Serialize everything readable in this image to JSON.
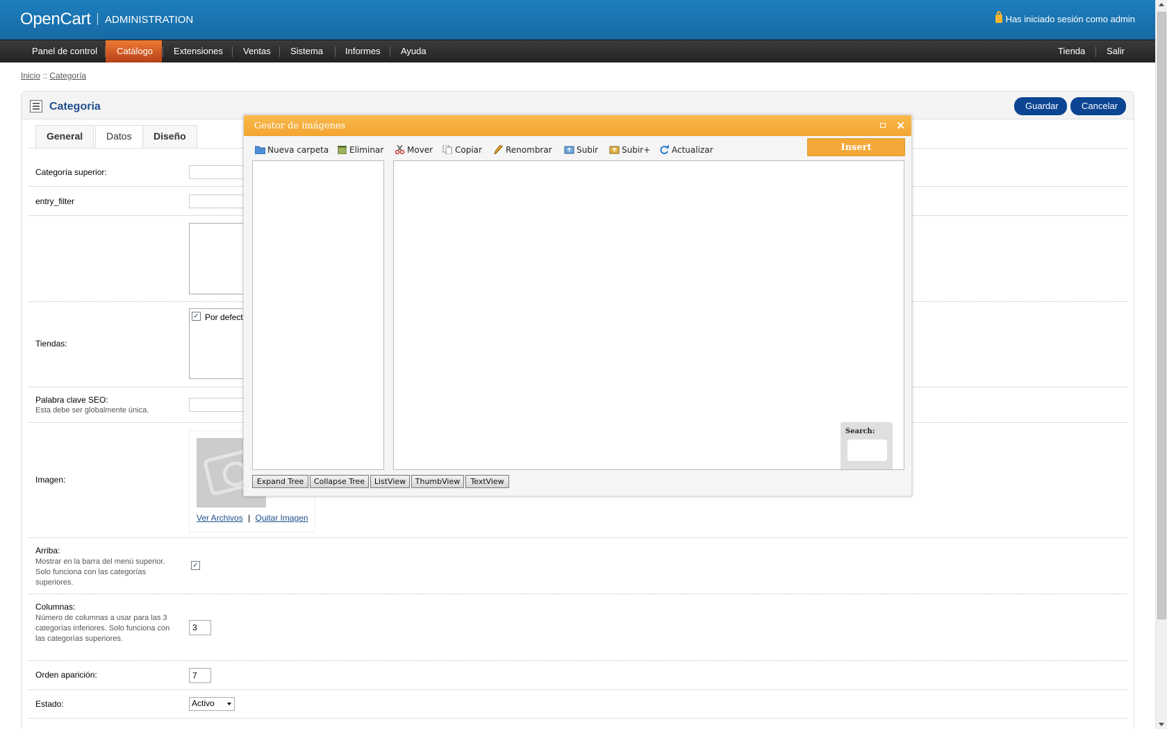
{
  "header": {
    "logo": "OpenCart",
    "subtitle": "ADMINISTRATION",
    "login_text": "Has iniciado sesión como admin",
    "lock_icon": "lock-icon"
  },
  "menu": {
    "items": [
      "Panel de control",
      "Catálogo",
      "Extensiones",
      "Ventas",
      "Sistema",
      "Informes",
      "Ayuda"
    ],
    "active": "Catálogo",
    "right_items": [
      "Tienda",
      "Salir"
    ]
  },
  "breadcrumb": {
    "home": "Inicio",
    "separator": "::",
    "current": "Categoría"
  },
  "page": {
    "title": "Categoria",
    "save_label": "Guardar",
    "cancel_label": "Cancelar"
  },
  "tabs": [
    "General",
    "Datos",
    "Diseño"
  ],
  "active_tab": "Datos",
  "form": {
    "parent_label": "Categoría superior:",
    "filter_label": "entry_filter",
    "stores_label": "Tiendas:",
    "stores_default": "Por defecto",
    "seo_label": "Palabra clave SEO:",
    "seo_help": "Esta debe ser globalmente única.",
    "image_label": "Imagen:",
    "image_browse": "Ver Archivos",
    "image_sep": "|",
    "image_remove": "Quitar Imagen",
    "top_label": "Arriba:",
    "top_help": "Mostrar en la barra del menú superior. Solo funciona con las categorías superiores.",
    "columns_label": "Columnas:",
    "columns_help": "Número de columnas a usar para las 3 categorías inferiores. Solo funciona con las categorías superiores.",
    "columns_value": "3",
    "sort_label": "Orden aparición:",
    "sort_value": "7",
    "status_label": "Estado:",
    "status_value": "Activo"
  },
  "modal": {
    "title": "Gestor de imágenes",
    "toolbar": [
      "Nueva carpeta",
      "Eliminar",
      "Mover",
      "Copiar",
      "Renombrar",
      "Subir",
      "Subir+",
      "Actualizar"
    ],
    "insert_label": "Insert",
    "search_label": "Search:",
    "view_buttons": [
      "Expand Tree",
      "Collapse Tree",
      "ListView",
      "ThumbView",
      "TextView"
    ]
  },
  "colors": {
    "header_blue": "#1d7fbe",
    "menu_active": "#e0662a",
    "modal_orange": "#f4a83a",
    "button_navy": "#0c4592"
  }
}
